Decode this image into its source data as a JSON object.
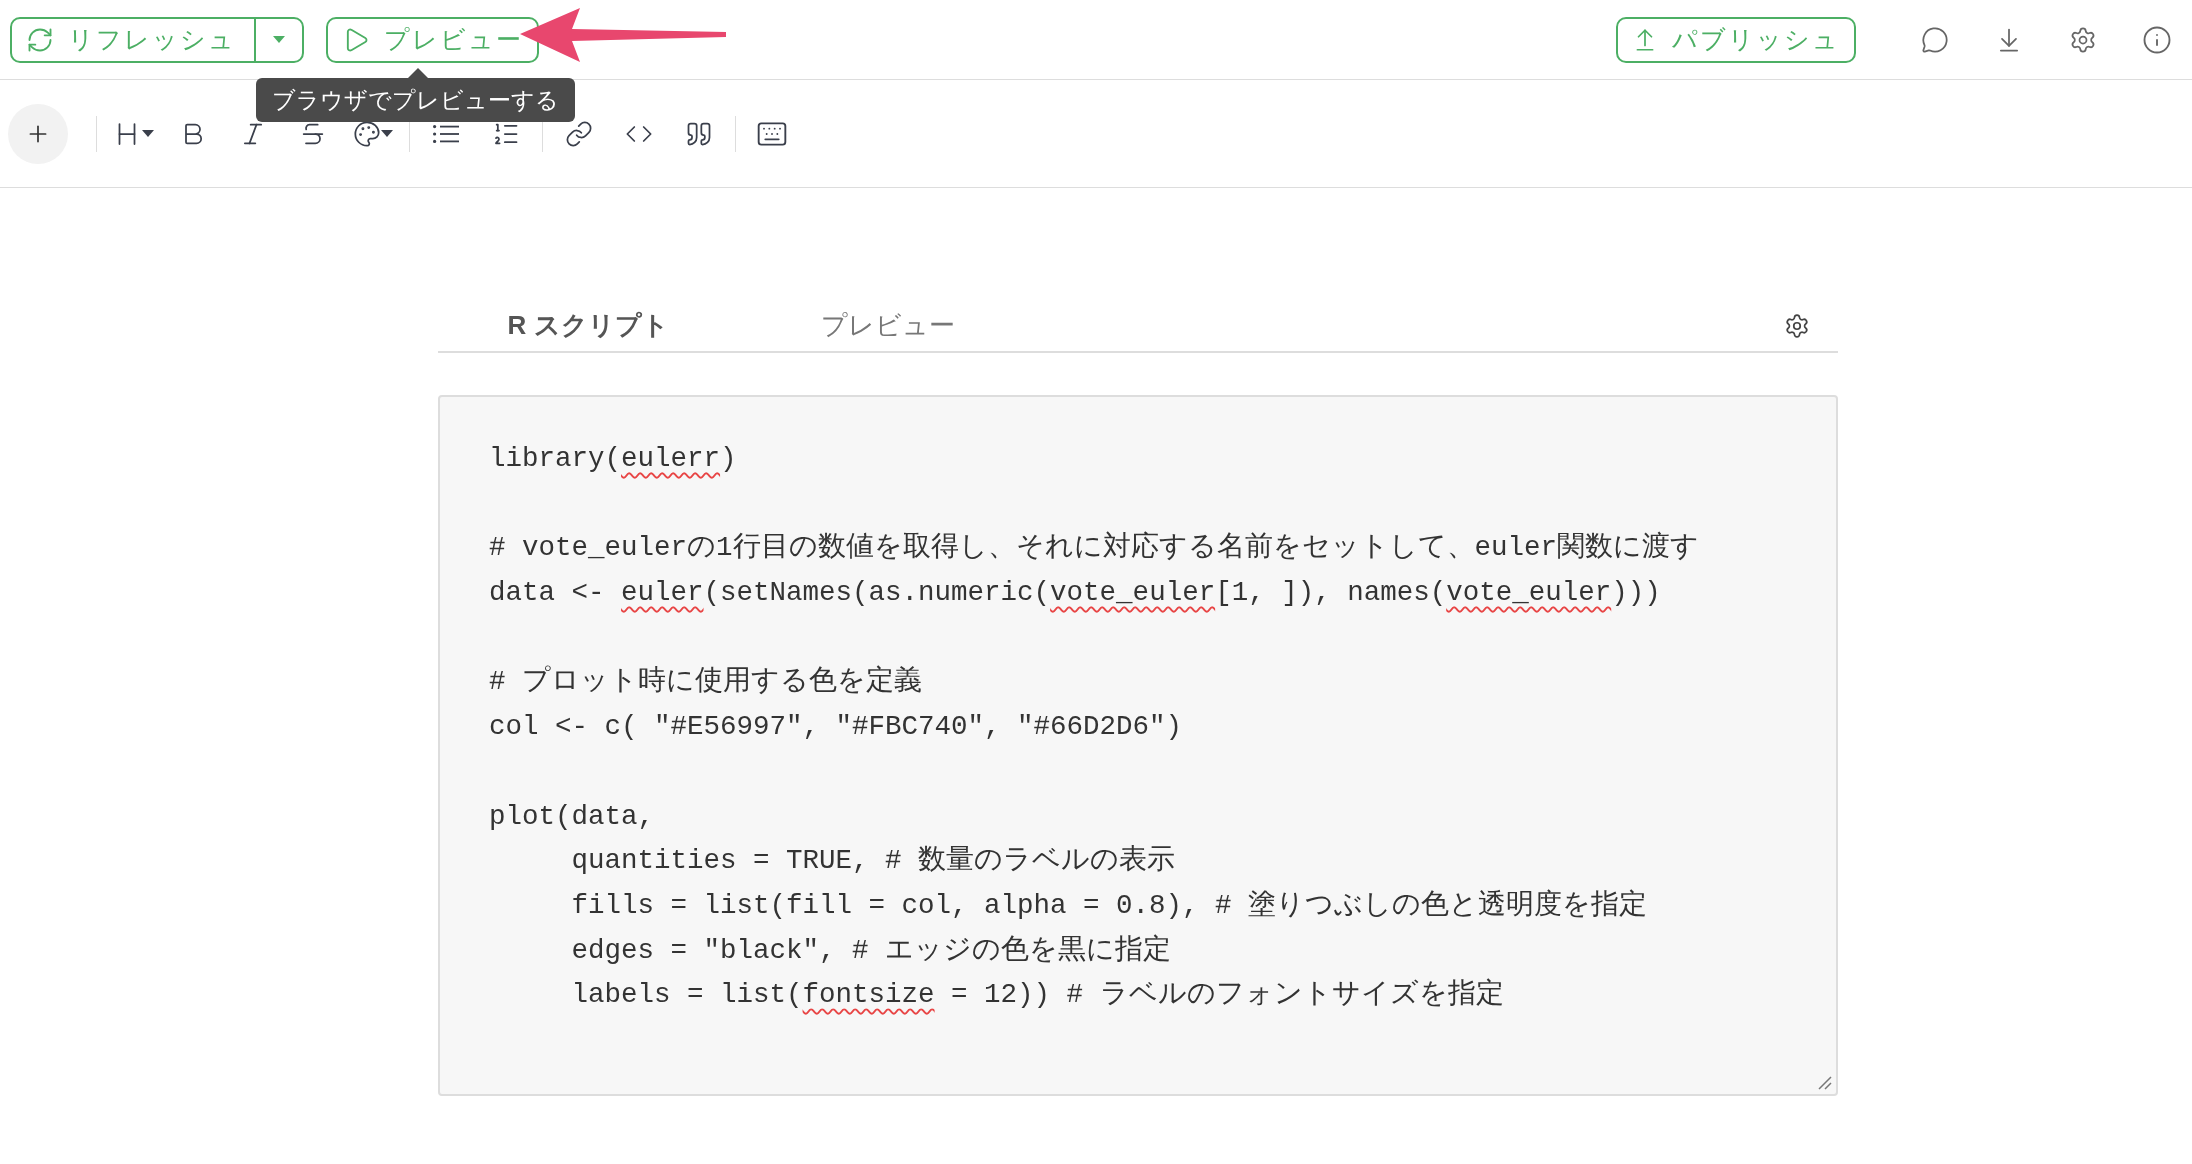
{
  "header": {
    "refresh_button": {
      "label": "リフレッシュ"
    },
    "preview_button": {
      "label": "プレビュー"
    },
    "publish_button": {
      "label": "パブリッシュ"
    }
  },
  "tooltip": {
    "text": "ブラウザでプレビューする"
  },
  "tabs": [
    {
      "label": "R スクリプト",
      "selected": true
    },
    {
      "label": "プレビュー",
      "selected": false
    }
  ],
  "code_blocks": [
    [
      {
        "segments": [
          {
            "text": "library(",
            "misspelled": false
          },
          {
            "text": "eulerr",
            "misspelled": true
          },
          {
            "text": ")",
            "misspelled": false
          }
        ]
      }
    ],
    [
      {
        "segments": [
          {
            "text": "# vote_eulerの1行目の数値を取得し、それに対応する名前をセットして、euler関数に渡す",
            "misspelled": false
          }
        ]
      },
      {
        "segments": [
          {
            "text": "data <- ",
            "misspelled": false
          },
          {
            "text": "euler",
            "misspelled": true
          },
          {
            "text": "(setNames(as.numeric(",
            "misspelled": false
          },
          {
            "text": "vote_euler",
            "misspelled": true
          },
          {
            "text": "[1, ]), names(",
            "misspelled": false
          },
          {
            "text": "vote_euler",
            "misspelled": true
          },
          {
            "text": ")))",
            "misspelled": false
          }
        ]
      }
    ],
    [
      {
        "segments": [
          {
            "text": "# プロット時に使用する色を定義",
            "misspelled": false
          }
        ]
      },
      {
        "segments": [
          {
            "text": "col <- c( \"#E56997\", \"#FBC740\", \"#66D2D6\")",
            "misspelled": false
          }
        ]
      }
    ],
    [
      {
        "segments": [
          {
            "text": "plot(data,",
            "misspelled": false
          }
        ]
      },
      {
        "segments": [
          {
            "text": "     quantities = TRUE, # 数量のラベルの表示",
            "misspelled": false
          }
        ]
      },
      {
        "segments": [
          {
            "text": "     fills = list(fill = col, alpha = 0.8), # 塗りつぶしの色と透明度を指定",
            "misspelled": false
          }
        ]
      },
      {
        "segments": [
          {
            "text": "     edges = \"black\", # エッジの色を黒に指定",
            "misspelled": false
          }
        ]
      },
      {
        "segments": [
          {
            "text": "     labels = list(",
            "misspelled": false
          },
          {
            "text": "fontsize",
            "misspelled": true
          },
          {
            "text": " = 12)) # ラベルのフォントサイズを指定",
            "misspelled": false
          }
        ]
      }
    ]
  ]
}
